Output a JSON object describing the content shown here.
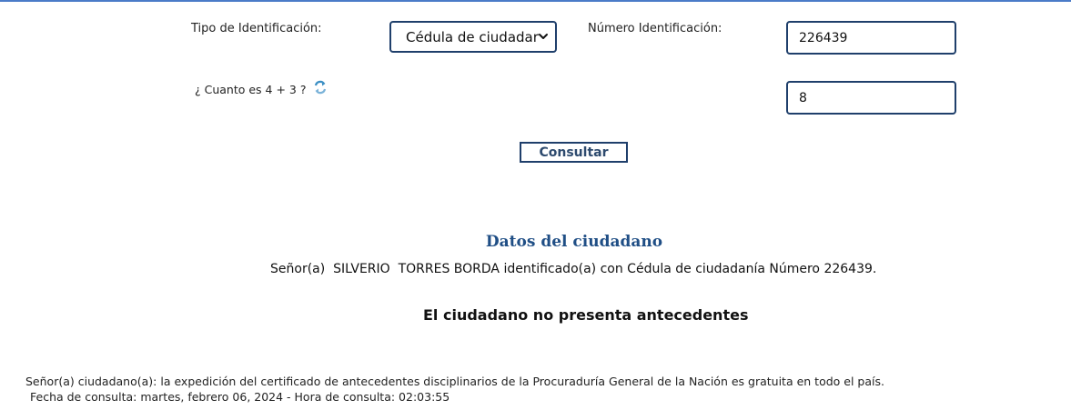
{
  "form": {
    "id_type_label": "Tipo de Identificación:",
    "id_type_selected": "Cédula de ciudadar",
    "id_number_label": "Número Identificación:",
    "id_number_value": "226439",
    "captcha_question": "¿ Cuanto es 4 + 3 ?",
    "captcha_answer": "8",
    "refresh_icon": "refresh-icon",
    "submit_label": "Consultar"
  },
  "result": {
    "title": "Datos del ciudadano",
    "citizen_line": "Señor(a)  SILVERIO  TORRES BORDA identificado(a) con Cédula de ciudadanía Número 226439.",
    "status": "El ciudadano no presenta antecedentes"
  },
  "footer": {
    "notice": "Señor(a) ciudadano(a): la expedición del certificado de antecedentes disciplinarios de la Procuraduría General de la Nación es gratuita en todo el país.",
    "timestamp": "Fecha de consulta: martes, febrero 06, 2024 - Hora de consulta: 02:03:55"
  },
  "colors": {
    "accent": "#1f3f6b",
    "title_blue": "#1f4e85",
    "top_rule": "#4a7bc8"
  }
}
